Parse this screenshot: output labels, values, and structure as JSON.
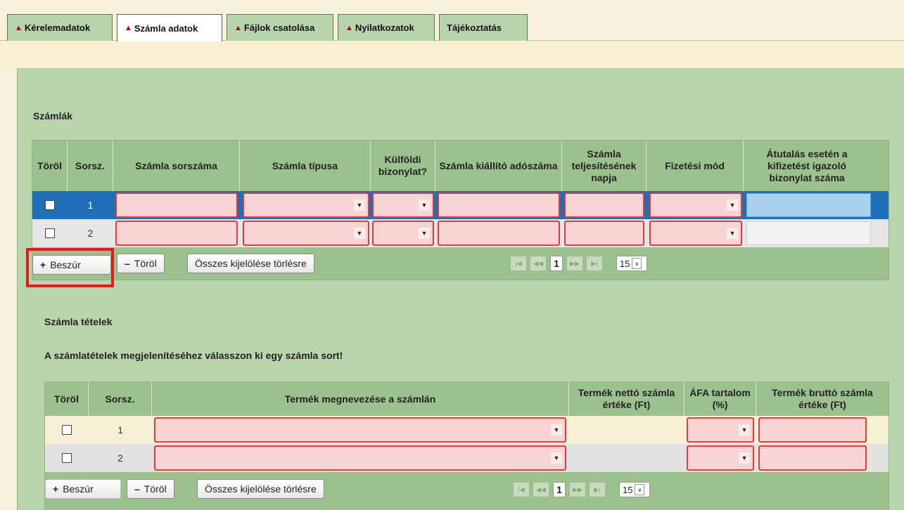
{
  "tabs": [
    {
      "label": "Kérelemadatok",
      "warn": true
    },
    {
      "label": "Számla adatok",
      "warn": true,
      "active": true
    },
    {
      "label": "Fájlok csatolása",
      "warn": true
    },
    {
      "label": "Nyilatkozatok",
      "warn": true
    },
    {
      "label": "Tájékoztatás",
      "warn": false
    }
  ],
  "warn_icon": "warning-triangle-icon",
  "invoices": {
    "title": "Számlák",
    "headers": {
      "delete": "Töröl",
      "seq": "Sorsz.",
      "number": "Számla sorszáma",
      "type": "Számla típusa",
      "foreign": "Külföldi bizonylat?",
      "issuer_tax": "Számla kiállító adószáma",
      "fulfillment": "Számla teljesítésének napja",
      "payment": "Fizetési mód",
      "transfer": "Átutalás esetén a kifizetést igazoló bizonylat száma"
    },
    "rows": [
      {
        "seq": "1",
        "selected": true
      },
      {
        "seq": "2",
        "selected": false
      }
    ],
    "buttons": {
      "insert": "Beszúr",
      "insert_glyph": "+",
      "delete": "Töröl",
      "delete_glyph": "–",
      "select_all": "Összes kijelölése törlésre"
    },
    "pager": {
      "page": "1",
      "size": "15"
    }
  },
  "items": {
    "title": "Számla tételek",
    "hint": "A számlatételek megjelenítéséhez válasszon ki egy számla sort!",
    "headers": {
      "delete": "Töröl",
      "seq": "Sorsz.",
      "product": "Termék megnevezése a számlán",
      "net": "Termék nettó számla értéke (Ft)",
      "vat": "ÁFA tartalom (%)",
      "gross": "Termék bruttó számla értéke (Ft)"
    },
    "rows": [
      {
        "seq": "1"
      },
      {
        "seq": "2"
      }
    ],
    "buttons": {
      "insert": "Beszúr",
      "insert_glyph": "+",
      "delete": "Töröl",
      "delete_glyph": "–",
      "select_all": "Összes kijelölése törlésre"
    },
    "pager": {
      "page": "1",
      "size": "15"
    }
  },
  "colors": {
    "panel": "#b9d5ae",
    "header": "#9dc08f",
    "invalid_border": "#e03a3a",
    "invalid_fill": "#f8d4d4",
    "selected_row": "#1f6eb8",
    "highlight": "#e01c1c"
  }
}
